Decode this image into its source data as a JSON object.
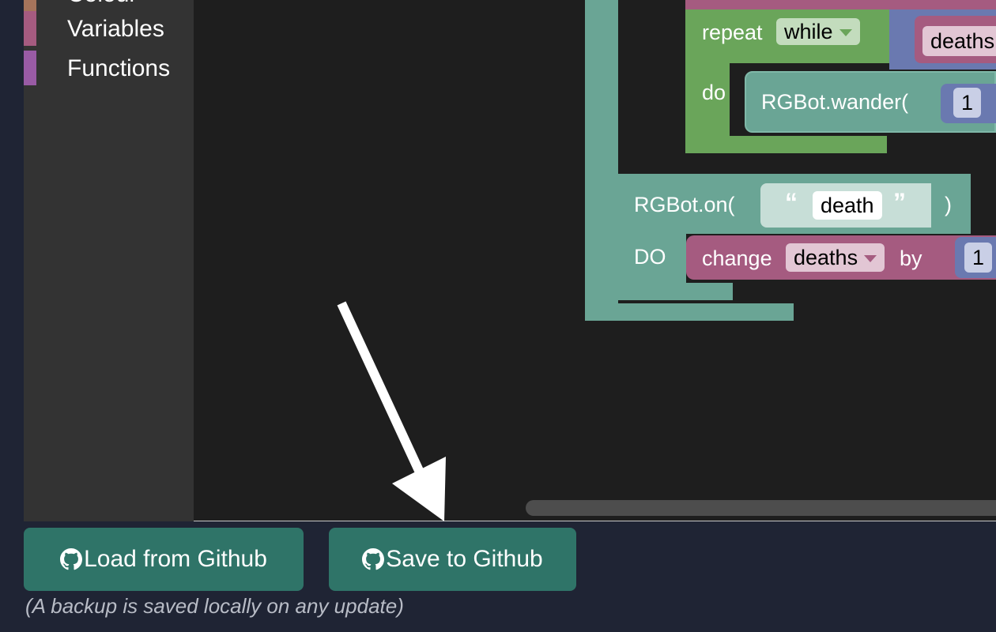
{
  "toolbox": {
    "categories": [
      {
        "label": "Colour",
        "color": "#a5745b"
      },
      {
        "label": "Variables",
        "color": "#a55b80"
      },
      {
        "label": "Functions",
        "color": "#995ba5"
      }
    ]
  },
  "workspace": {
    "repeat_label": "repeat",
    "repeat_mode": "while",
    "repeat_var": "deaths",
    "do_label": "do",
    "wander_label": "RGBot.wander(",
    "wander_arg": "1",
    "on_label": "RGBot.on(",
    "on_open_quote": "“",
    "on_event": "death",
    "on_close_quote": "”",
    "on_close_paren": ")",
    "DO_label": "DO",
    "change_label": "change",
    "change_var": "deaths",
    "by_label": "by",
    "change_amount": "1"
  },
  "actions": {
    "load_label": "Load from Github",
    "save_label": "Save to Github",
    "backup_note": "(A backup is saved locally on any update)"
  },
  "colors": {
    "button_bg": "#2f7468",
    "background": "#1f2434",
    "workspace_bg": "#1e1e1e",
    "toolbox_bg": "#333333"
  }
}
